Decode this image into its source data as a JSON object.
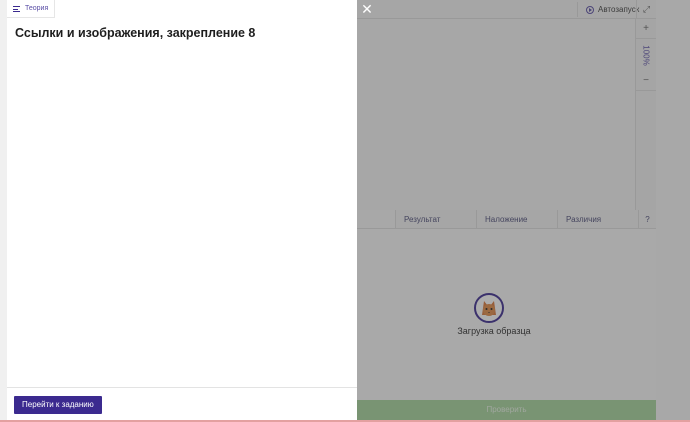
{
  "theory_panel": {
    "tab_label": "Теория",
    "title": "Ссылки и изображения, закрепление 8",
    "goto_button": "Перейти к заданию"
  },
  "workspace": {
    "autorun_label": "Автозапуск",
    "zoom_in": "+",
    "zoom_level": "100%",
    "zoom_out": "−",
    "tabs": [
      {
        "label": "Результат"
      },
      {
        "label": "Наложение"
      },
      {
        "label": "Различия"
      },
      {
        "label": "?"
      }
    ],
    "loading_text": "Загрузка образца",
    "check_button": "Проверить"
  },
  "colors": {
    "accent": "#3b2a8f",
    "check_button": "#a6d49b"
  }
}
